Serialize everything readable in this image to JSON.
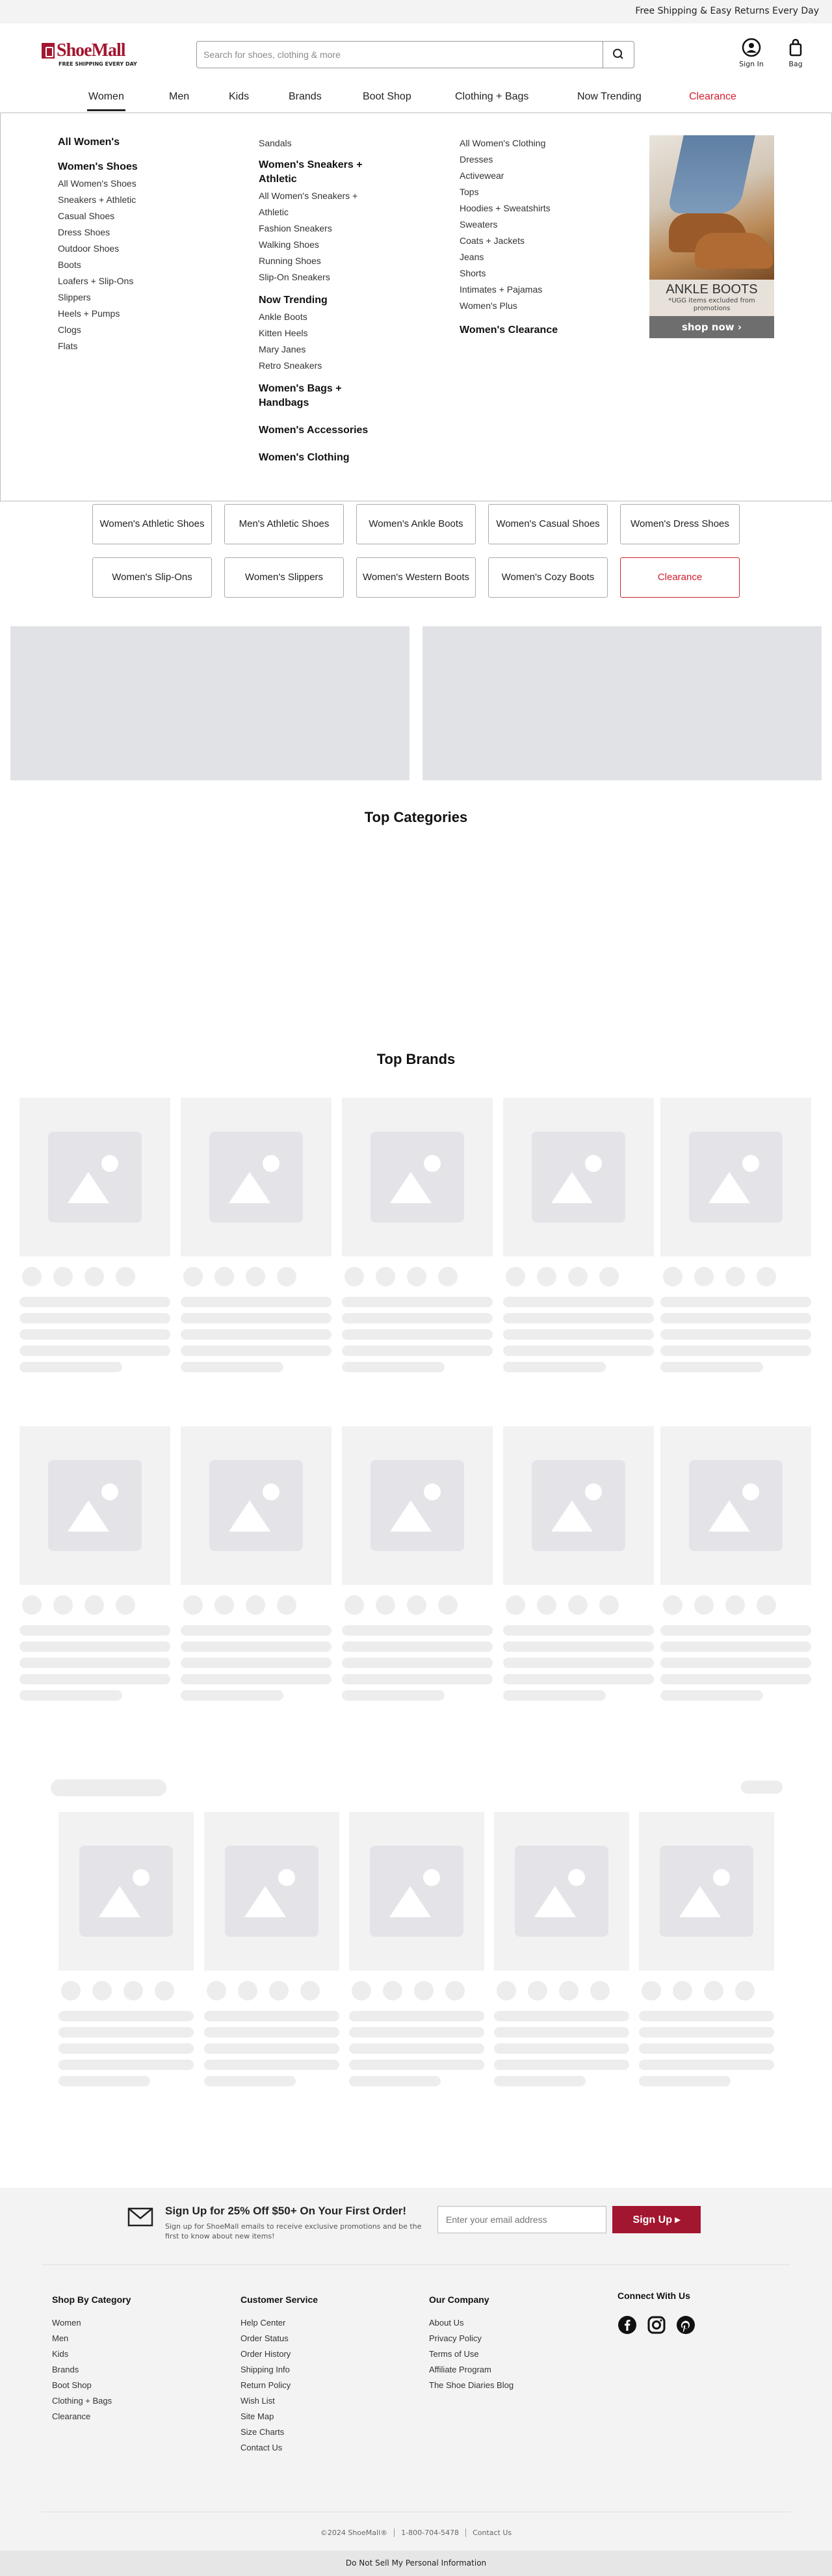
{
  "topbar": {
    "message": "Free Shipping & Easy Returns Every Day"
  },
  "header": {
    "logo_text": "ShoeMall",
    "logo_tagline": "FREE SHIPPING EVERY DAY",
    "search_placeholder": "Search for shoes, clothing & more",
    "sign_in_label": "Sign In",
    "bag_label": "Bag"
  },
  "nav": {
    "items": [
      "Women",
      "Men",
      "Kids",
      "Brands",
      "Boot Shop",
      "Clothing + Bags",
      "Now Trending",
      "Clearance"
    ],
    "active": "Women"
  },
  "mega_menu": {
    "all_link": "All Women's",
    "col1": {
      "heading": "Women's Shoes",
      "links": [
        "All Women's Shoes",
        "Sneakers + Athletic",
        "Casual Shoes",
        "Dress Shoes",
        "Outdoor Shoes",
        "Boots",
        "Loafers + Slip-Ons",
        "Slippers",
        "Heels + Pumps",
        "Clogs",
        "Flats"
      ]
    },
    "col2": {
      "top_link": "Sandals",
      "sneakers_heading": "Women's Sneakers + Athletic",
      "sneakers_links": [
        "All Women's Sneakers + Athletic",
        "Fashion Sneakers",
        "Walking Shoes",
        "Running Shoes",
        "Slip-On Sneakers"
      ],
      "trending_heading": "Now Trending",
      "trending_links": [
        "Ankle Boots",
        "Kitten Heels",
        "Mary Janes",
        "Retro Sneakers"
      ],
      "bags_heading": "Women's Bags + Handbags",
      "accessories_heading": "Women's Accessories",
      "clothing_heading": "Women's Clothing"
    },
    "col3": {
      "links": [
        "All Women's Clothing",
        "Dresses",
        "Activewear",
        "Tops",
        "Hoodies + Sweatshirts",
        "Sweaters",
        "Coats + Jackets",
        "Jeans",
        "Shorts",
        "Intimates + Pajamas",
        "Women's Plus"
      ],
      "clearance_heading": "Women's Clearance"
    },
    "promo": {
      "title": "ANKLE BOOTS",
      "note": "*UGG items excluded from promotions",
      "cta": "shop now ›"
    }
  },
  "category_pills": {
    "row1": [
      "Women's Athletic Shoes",
      "Men's Athletic Shoes",
      "Women's Ankle Boots",
      "Women's Casual Shoes",
      "Women's Dress Shoes"
    ],
    "row2": [
      "Women's Slip-Ons",
      "Women's Slippers",
      "Women's Western Boots",
      "Women's Cozy Boots",
      "Clearance"
    ]
  },
  "sections": {
    "top_categories": "Top Categories",
    "top_brands": "Top Brands"
  },
  "newsletter": {
    "title": "Sign Up for 25% Off $50+ On Your First Order!",
    "subtitle": "Sign up for ShoeMall emails to receive exclusive promotions and be the first to know about new items!",
    "input_placeholder": "Enter your email address",
    "button": "Sign Up ▸"
  },
  "footer": {
    "shop": {
      "heading": "Shop By Category",
      "links": [
        "Women",
        "Men",
        "Kids",
        "Brands",
        "Boot Shop",
        "Clothing + Bags",
        "Clearance"
      ]
    },
    "service": {
      "heading": "Customer Service",
      "links": [
        "Help Center",
        "Order Status",
        "Order History",
        "Shipping Info",
        "Return Policy",
        "Wish List",
        "Site Map",
        "Size Charts",
        "Contact Us"
      ]
    },
    "company": {
      "heading": "Our Company",
      "links": [
        "About Us",
        "Privacy Policy",
        "Terms of Use",
        "Affiliate Program",
        "The Shoe Diaries Blog"
      ]
    },
    "connect": {
      "heading": "Connect With Us"
    },
    "legal": [
      "©2024 ShoeMall®",
      "1-800-704-5478",
      "Contact Us"
    ],
    "do_not_sell": "Do Not Sell My Personal Information"
  },
  "colors": {
    "brand": "#a3162f",
    "clearance": "#d21e2d",
    "skeleton": "#ededee"
  }
}
